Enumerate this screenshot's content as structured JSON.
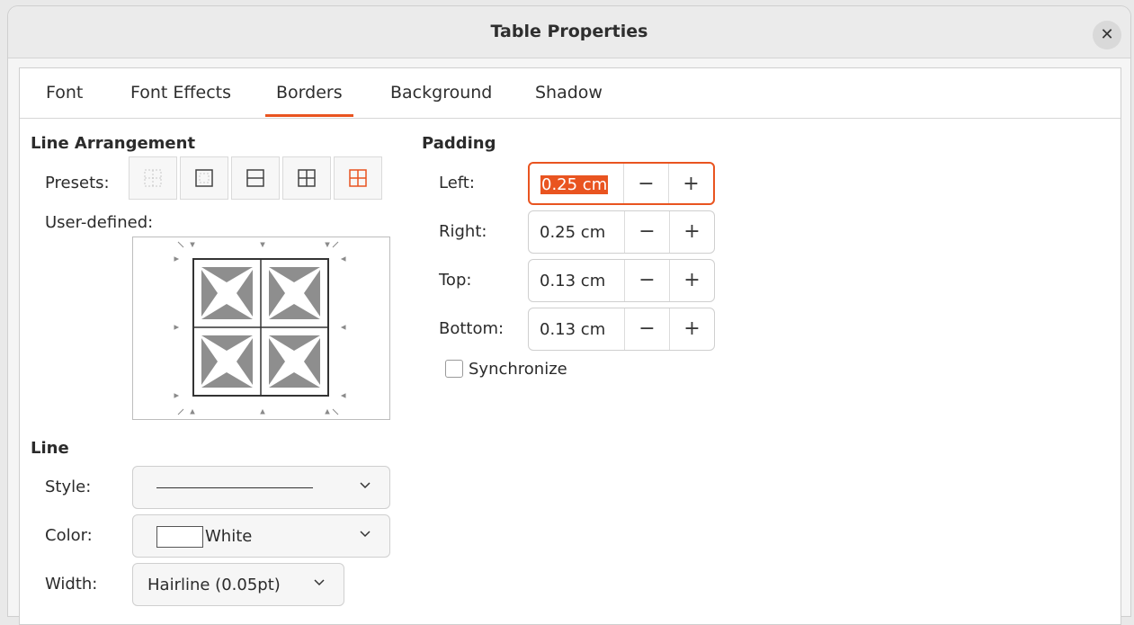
{
  "dialog": {
    "title": "Table Properties"
  },
  "tabs": [
    {
      "label": "Font"
    },
    {
      "label": "Font Effects"
    },
    {
      "label": "Borders",
      "active": true
    },
    {
      "label": "Background"
    },
    {
      "label": "Shadow"
    }
  ],
  "line_arrangement": {
    "title": "Line Arrangement",
    "presets_label": "Presets:",
    "user_defined_label": "User-defined:",
    "presets": [
      "none-icon",
      "outer-border-icon",
      "outer-horizontal-icon",
      "outer-all-inner-icon",
      "outer-only-keep-inner-icon"
    ]
  },
  "line": {
    "title": "Line",
    "style_label": "Style:",
    "color_label": "Color:",
    "color_value": "White",
    "width_label": "Width:",
    "width_value": "Hairline (0.05pt)"
  },
  "padding": {
    "title": "Padding",
    "fields": [
      {
        "label": "Left:",
        "value": "0.25 cm"
      },
      {
        "label": "Right:",
        "value": "0.25 cm"
      },
      {
        "label": "Top:",
        "value": "0.13 cm"
      },
      {
        "label": "Bottom:",
        "value": "0.13 cm"
      }
    ],
    "synchronize_label": "Synchronize",
    "synchronize_checked": false
  },
  "colors": {
    "accent": "#e95420",
    "swatch": "#ffffff"
  }
}
